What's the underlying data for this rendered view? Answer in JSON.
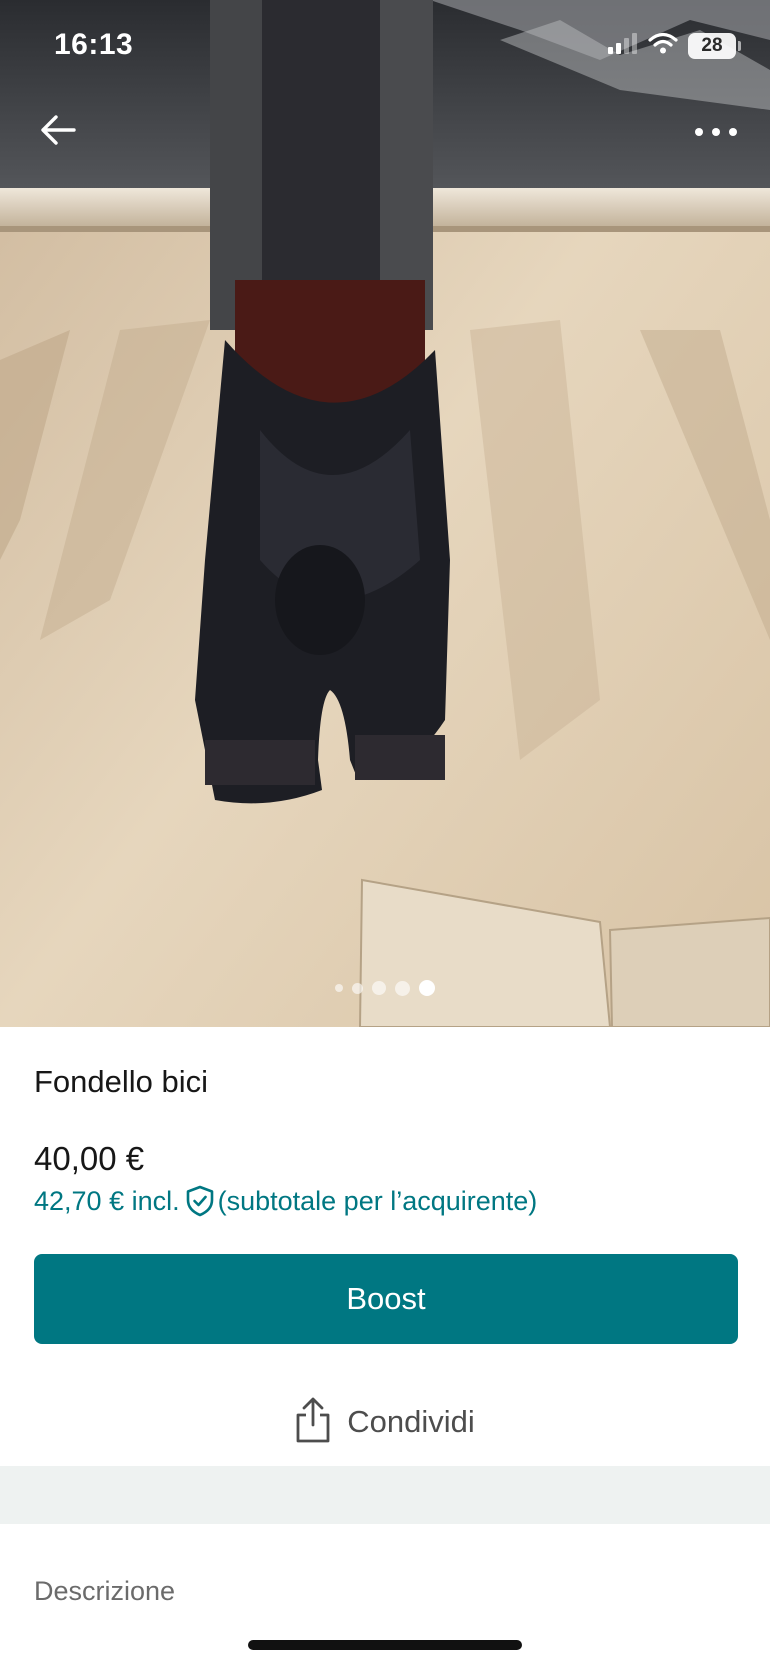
{
  "status_bar": {
    "time": "16:13",
    "battery_level": "28",
    "icons": [
      "signal-icon",
      "wifi-icon",
      "battery-icon"
    ]
  },
  "header": {
    "back_icon": "arrow-left-icon",
    "more_icon": "more-horizontal-icon"
  },
  "gallery": {
    "photo_count": 5,
    "active_index": 4
  },
  "item": {
    "title": "Fondello bici",
    "price": "40,00 €",
    "price_incl": "42,70 € incl.",
    "price_incl_icon": "shield-check-icon",
    "price_incl_note": "(subtotale per l’acquirente)"
  },
  "actions": {
    "boost_label": "Boost",
    "share_label": "Condividi",
    "share_icon": "share-icon"
  },
  "description": {
    "heading": "Descrizione"
  },
  "colors": {
    "accent": "#007782",
    "text": "#171717",
    "muted": "#6b6b6b",
    "band": "#eef2f1"
  }
}
